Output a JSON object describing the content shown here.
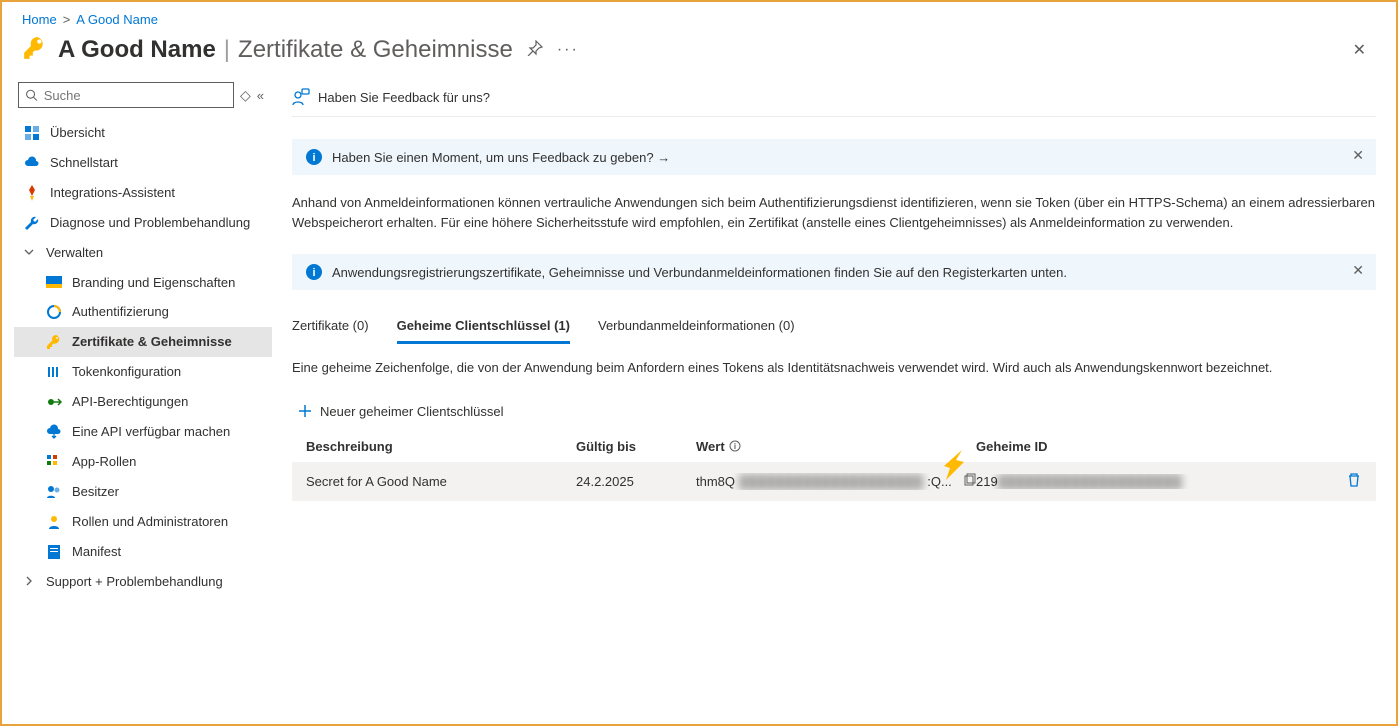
{
  "breadcrumb": {
    "home": "Home",
    "current": "A Good Name"
  },
  "header": {
    "title": "A Good Name",
    "subtitle": "Zertifikate & Geheimnisse"
  },
  "sidebar": {
    "search_placeholder": "Suche",
    "items": {
      "overview": "Übersicht",
      "quickstart": "Schnellstart",
      "integration": "Integrations-Assistent",
      "diag": "Diagnose und Problembehandlung",
      "manage": "Verwalten",
      "branding": "Branding und Eigenschaften",
      "auth": "Authentifizierung",
      "certs": "Zertifikate & Geheimnisse",
      "tokencfg": "Tokenkonfiguration",
      "apiperm": "API-Berechtigungen",
      "exposeapi": "Eine API verfügbar machen",
      "approles": "App-Rollen",
      "owners": "Besitzer",
      "roles": "Rollen und Administratoren",
      "manifest": "Manifest",
      "support": "Support + Problembehandlung"
    }
  },
  "cmdbar": {
    "feedback": "Haben Sie Feedback für uns?"
  },
  "banner1": {
    "text": "Haben Sie einen Moment, um uns Feedback zu geben? →"
  },
  "desc": "Anhand von Anmeldeinformationen können vertrauliche Anwendungen sich beim Authentifizierungsdienst identifizieren, wenn sie Token (über ein HTTPS-Schema) an einem adressierbaren Webspeicherort erhalten. Für eine höhere Sicherheitsstufe wird empfohlen, ein Zertifikat (anstelle eines Clientgeheimnisses) als Anmeldeinformation zu verwenden.",
  "banner2": {
    "text": "Anwendungsregistrierungszertifikate, Geheimnisse und Verbundanmeldeinformationen finden Sie auf den Registerkarten unten."
  },
  "tabs": {
    "certs": "Zertifikate (0)",
    "secrets": "Geheime Clientschlüssel (1)",
    "federated": "Verbundanmeldeinformationen (0)"
  },
  "tabdesc": "Eine geheime Zeichenfolge, die von der Anwendung beim Anfordern eines Tokens als Identitätsnachweis verwendet wird. Wird auch als Anwendungskennwort bezeichnet.",
  "addnew": "Neuer geheimer Clientschlüssel",
  "table": {
    "headers": {
      "desc": "Beschreibung",
      "expires": "Gültig bis",
      "value": "Wert",
      "secretid": "Geheime ID"
    },
    "row": {
      "desc": "Secret for A Good Name",
      "expires": "24.2.2025",
      "value_visible": "thm8Q",
      "value_tail": ":Q...",
      "id_visible": "219",
      "hidden": "████████████████████"
    }
  }
}
